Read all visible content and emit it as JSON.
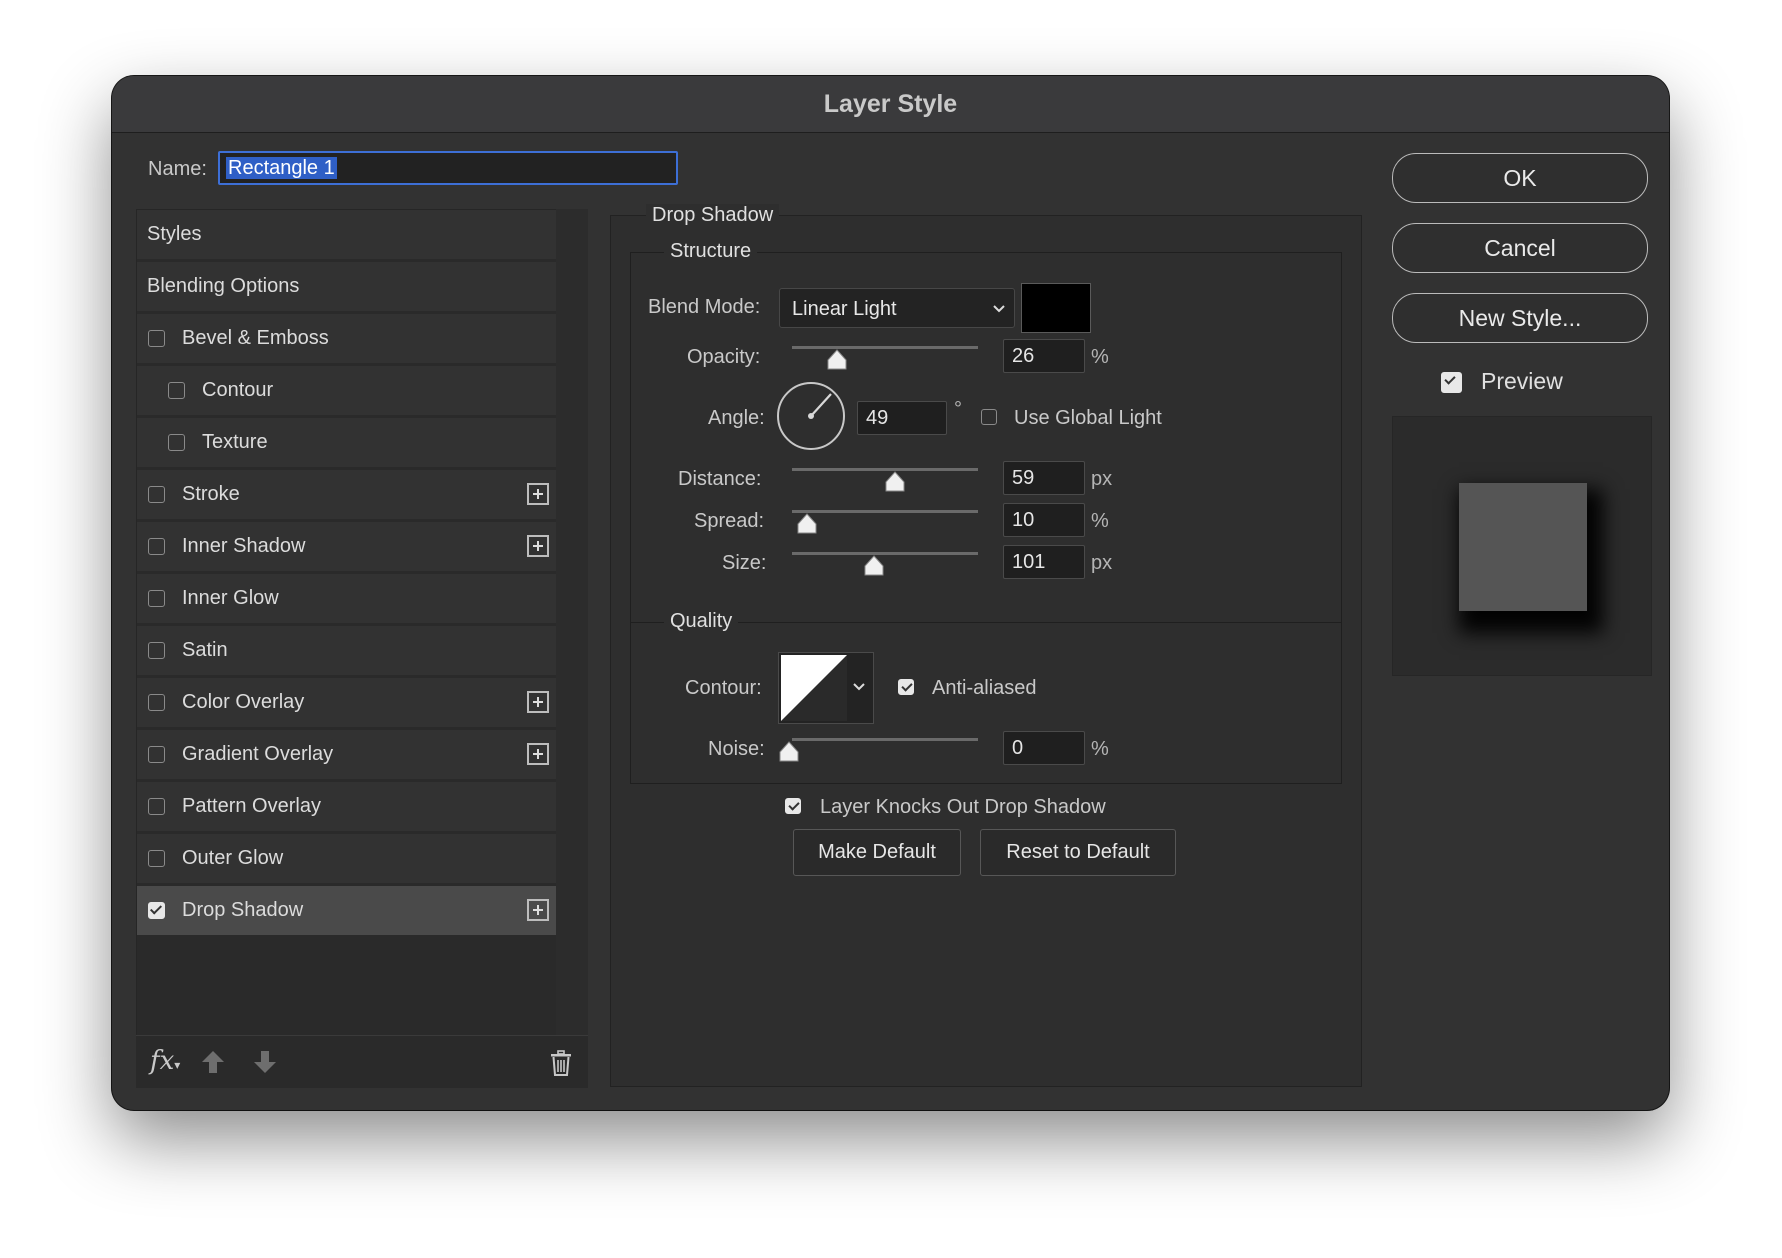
{
  "dialog": {
    "title": "Layer Style"
  },
  "name": {
    "label": "Name:",
    "value": "Rectangle 1"
  },
  "style_list": [
    {
      "label": "Styles",
      "checkbox": null,
      "plus": false
    },
    {
      "label": "Blending Options",
      "checkbox": null,
      "plus": false
    },
    {
      "label": "Bevel & Emboss",
      "checkbox": false,
      "plus": false
    },
    {
      "label": "Contour",
      "checkbox": false,
      "plus": false,
      "indent": true
    },
    {
      "label": "Texture",
      "checkbox": false,
      "plus": false,
      "indent": true
    },
    {
      "label": "Stroke",
      "checkbox": false,
      "plus": true
    },
    {
      "label": "Inner Shadow",
      "checkbox": false,
      "plus": true
    },
    {
      "label": "Inner Glow",
      "checkbox": false,
      "plus": false
    },
    {
      "label": "Satin",
      "checkbox": false,
      "plus": false
    },
    {
      "label": "Color Overlay",
      "checkbox": false,
      "plus": true
    },
    {
      "label": "Gradient Overlay",
      "checkbox": false,
      "plus": true
    },
    {
      "label": "Pattern Overlay",
      "checkbox": false,
      "plus": false
    },
    {
      "label": "Outer Glow",
      "checkbox": false,
      "plus": false
    },
    {
      "label": "Drop Shadow",
      "checkbox": true,
      "plus": true,
      "selected": true
    }
  ],
  "footer": {
    "fx_label": "fx"
  },
  "drop_shadow": {
    "section_title": "Drop Shadow",
    "structure": {
      "title": "Structure",
      "blend_mode_label": "Blend Mode:",
      "blend_mode_value": "Linear Light",
      "shadow_color": "#000000",
      "opacity_label": "Opacity:",
      "opacity_value": "26",
      "opacity_unit": "%",
      "angle_label": "Angle:",
      "angle_value": "49",
      "angle_unit": "°",
      "use_global_light_label": "Use Global Light",
      "use_global_light": false,
      "distance_label": "Distance:",
      "distance_value": "59",
      "distance_unit": "px",
      "spread_label": "Spread:",
      "spread_value": "10",
      "spread_unit": "%",
      "size_label": "Size:",
      "size_value": "101",
      "size_unit": "px"
    },
    "quality": {
      "title": "Quality",
      "contour_label": "Contour:",
      "anti_aliased_label": "Anti-aliased",
      "anti_aliased": true,
      "noise_label": "Noise:",
      "noise_value": "0",
      "noise_unit": "%"
    },
    "knockout_label": "Layer Knocks Out Drop Shadow",
    "knockout": true,
    "make_default_label": "Make Default",
    "reset_default_label": "Reset to Default"
  },
  "actions": {
    "ok_label": "OK",
    "cancel_label": "Cancel",
    "new_style_label": "New Style...",
    "preview_label": "Preview",
    "preview_checked": true
  },
  "colors": {
    "window_bg": "#323232",
    "accent": "#3d6fd6",
    "selected_row": "#4a4a4a"
  }
}
